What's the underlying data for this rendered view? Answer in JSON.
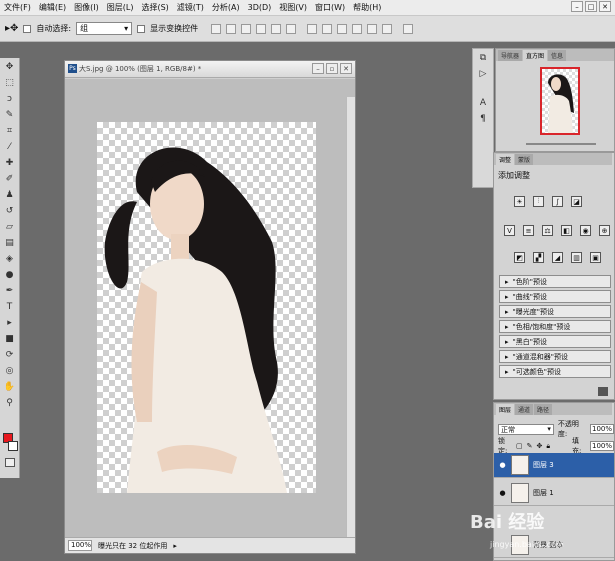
{
  "menu": [
    "文件(F)",
    "编辑(E)",
    "图像(I)",
    "图层(L)",
    "选择(S)",
    "滤镜(T)",
    "分析(A)",
    "3D(D)",
    "视图(V)",
    "窗口(W)",
    "帮助(H)"
  ],
  "options": {
    "auto_select_label": "自动选择:",
    "auto_select_value": "组",
    "show_transform_label": "显示变换控件"
  },
  "document": {
    "title": "大S.jpg @ 100% (图层 1, RGB/8#) *",
    "zoom": "100%",
    "status": "曝光只在 32 位起作用"
  },
  "panels": {
    "nav_tabs": [
      "导航器",
      "直方图",
      "信息"
    ],
    "adj_tabs": [
      "调整",
      "蒙版"
    ],
    "adj_title": "添加调整",
    "presets": [
      "\"色阶\"预设",
      "\"曲线\"预设",
      "\"曝光度\"预设",
      "\"色相/饱和度\"预设",
      "\"黑白\"预设",
      "\"通道混和器\"预设",
      "\"可选颜色\"预设"
    ],
    "layer_tabs": [
      "图层",
      "通道",
      "路径"
    ],
    "blend_mode": "正常",
    "opacity_label": "不透明度:",
    "opacity": "100%",
    "lock_label": "锁定:",
    "fill_label": "填充:",
    "fill": "100%",
    "layers": [
      "图层 3",
      "图层 1",
      "背景 副本"
    ]
  },
  "watermark": {
    "main": "Bai 经验",
    "sub": "jingyan.baidu.com"
  },
  "colors": {
    "foreground": "#e8181f",
    "background": "#ffffff",
    "selected_layer": "#2c5fa8"
  }
}
